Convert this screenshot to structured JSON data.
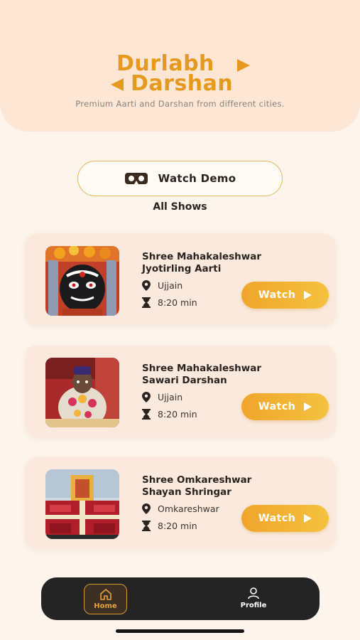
{
  "header": {
    "logo_line1": "Durlabh",
    "logo_line2": "Darshan",
    "tagline": "Premium Aarti and Darshan from different cities."
  },
  "demo": {
    "label": "Watch Demo",
    "icon": "vr-headset-icon"
  },
  "section_title": "All Shows",
  "shows": [
    {
      "title_line1": "Shree Mahakaleshwar",
      "title_line2": "Jyotirling Aarti",
      "location": "Ujjain",
      "duration": "8:20 min",
      "watch_label": "Watch"
    },
    {
      "title_line1": "Shree Mahakaleshwar",
      "title_line2": "Sawari Darshan",
      "location": "Ujjain",
      "duration": "8:20 min",
      "watch_label": "Watch"
    },
    {
      "title_line1": "Shree Omkareshwar",
      "title_line2": "Shayan Shringar",
      "location": "Omkareshwar",
      "duration": "8:20 min",
      "watch_label": "Watch"
    }
  ],
  "nav": {
    "home_label": "Home",
    "profile_label": "Profile"
  },
  "colors": {
    "accent": "#e59a1f",
    "header_bg": "#fde6d3",
    "card_bg": "#fae9dc",
    "nav_bg": "#242424"
  }
}
